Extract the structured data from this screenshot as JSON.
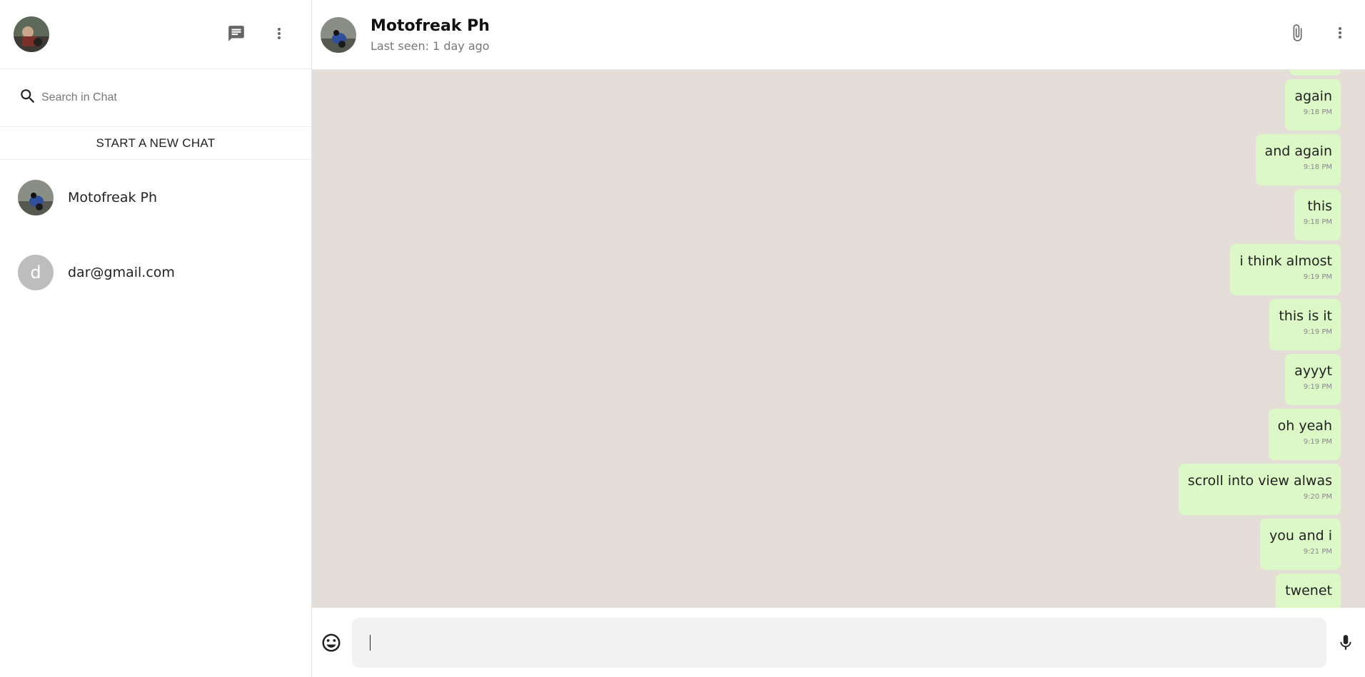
{
  "sidebar": {
    "search_placeholder": "Search in Chat",
    "new_chat_label": "START A NEW CHAT",
    "contacts": [
      {
        "name": "Motofreak Ph",
        "avatar": "photo"
      },
      {
        "name": "dar@gmail.com",
        "avatar_letter": "d"
      }
    ]
  },
  "chat": {
    "title": "Motofreak Ph",
    "last_seen": "Last seen: 1 day ago",
    "messages": [
      {
        "text": "again",
        "time": "9:18 PM"
      },
      {
        "text": "and again",
        "time": "9:18 PM"
      },
      {
        "text": "this",
        "time": "9:18 PM"
      },
      {
        "text": "i think almost",
        "time": "9:19 PM"
      },
      {
        "text": "this is it",
        "time": "9:19 PM"
      },
      {
        "text": "ayyyt",
        "time": "9:19 PM"
      },
      {
        "text": "oh yeah",
        "time": "9:19 PM"
      },
      {
        "text": "scroll into view alwas",
        "time": "9:20 PM"
      },
      {
        "text": "you and i",
        "time": "9:21 PM"
      },
      {
        "text": "twenet",
        "time": ""
      }
    ],
    "composer_value": ""
  },
  "colors": {
    "bubble": "#dcf8c6",
    "chat_background": "#e5ddd8"
  },
  "icons": [
    "chat-icon",
    "more-vert-icon",
    "search-icon",
    "attach-icon",
    "emoji-icon",
    "mic-icon"
  ]
}
